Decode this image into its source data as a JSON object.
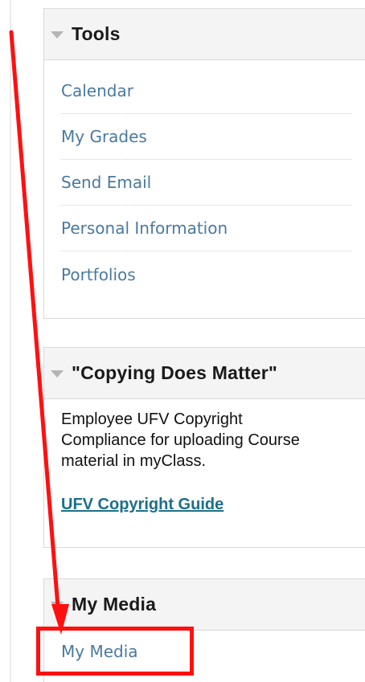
{
  "tools_module": {
    "title": "Tools",
    "items": [
      {
        "label": "Calendar"
      },
      {
        "label": "My Grades"
      },
      {
        "label": "Send Email"
      },
      {
        "label": "Personal Information"
      },
      {
        "label": "Portfolios"
      }
    ]
  },
  "copying_module": {
    "title": "\"Copying Does Matter\"",
    "body_text": "Employee UFV Copyright Compliance for uploading Course material in myClass.",
    "link_label": "UFV Copyright Guide"
  },
  "media_module": {
    "title": "My Media",
    "link_label": "My Media"
  },
  "colors": {
    "link": "#4a79a0",
    "annotation": "#ff1010",
    "header_bg": "#f4f4f4"
  },
  "icons": {
    "collapse": "caret-down-icon"
  }
}
